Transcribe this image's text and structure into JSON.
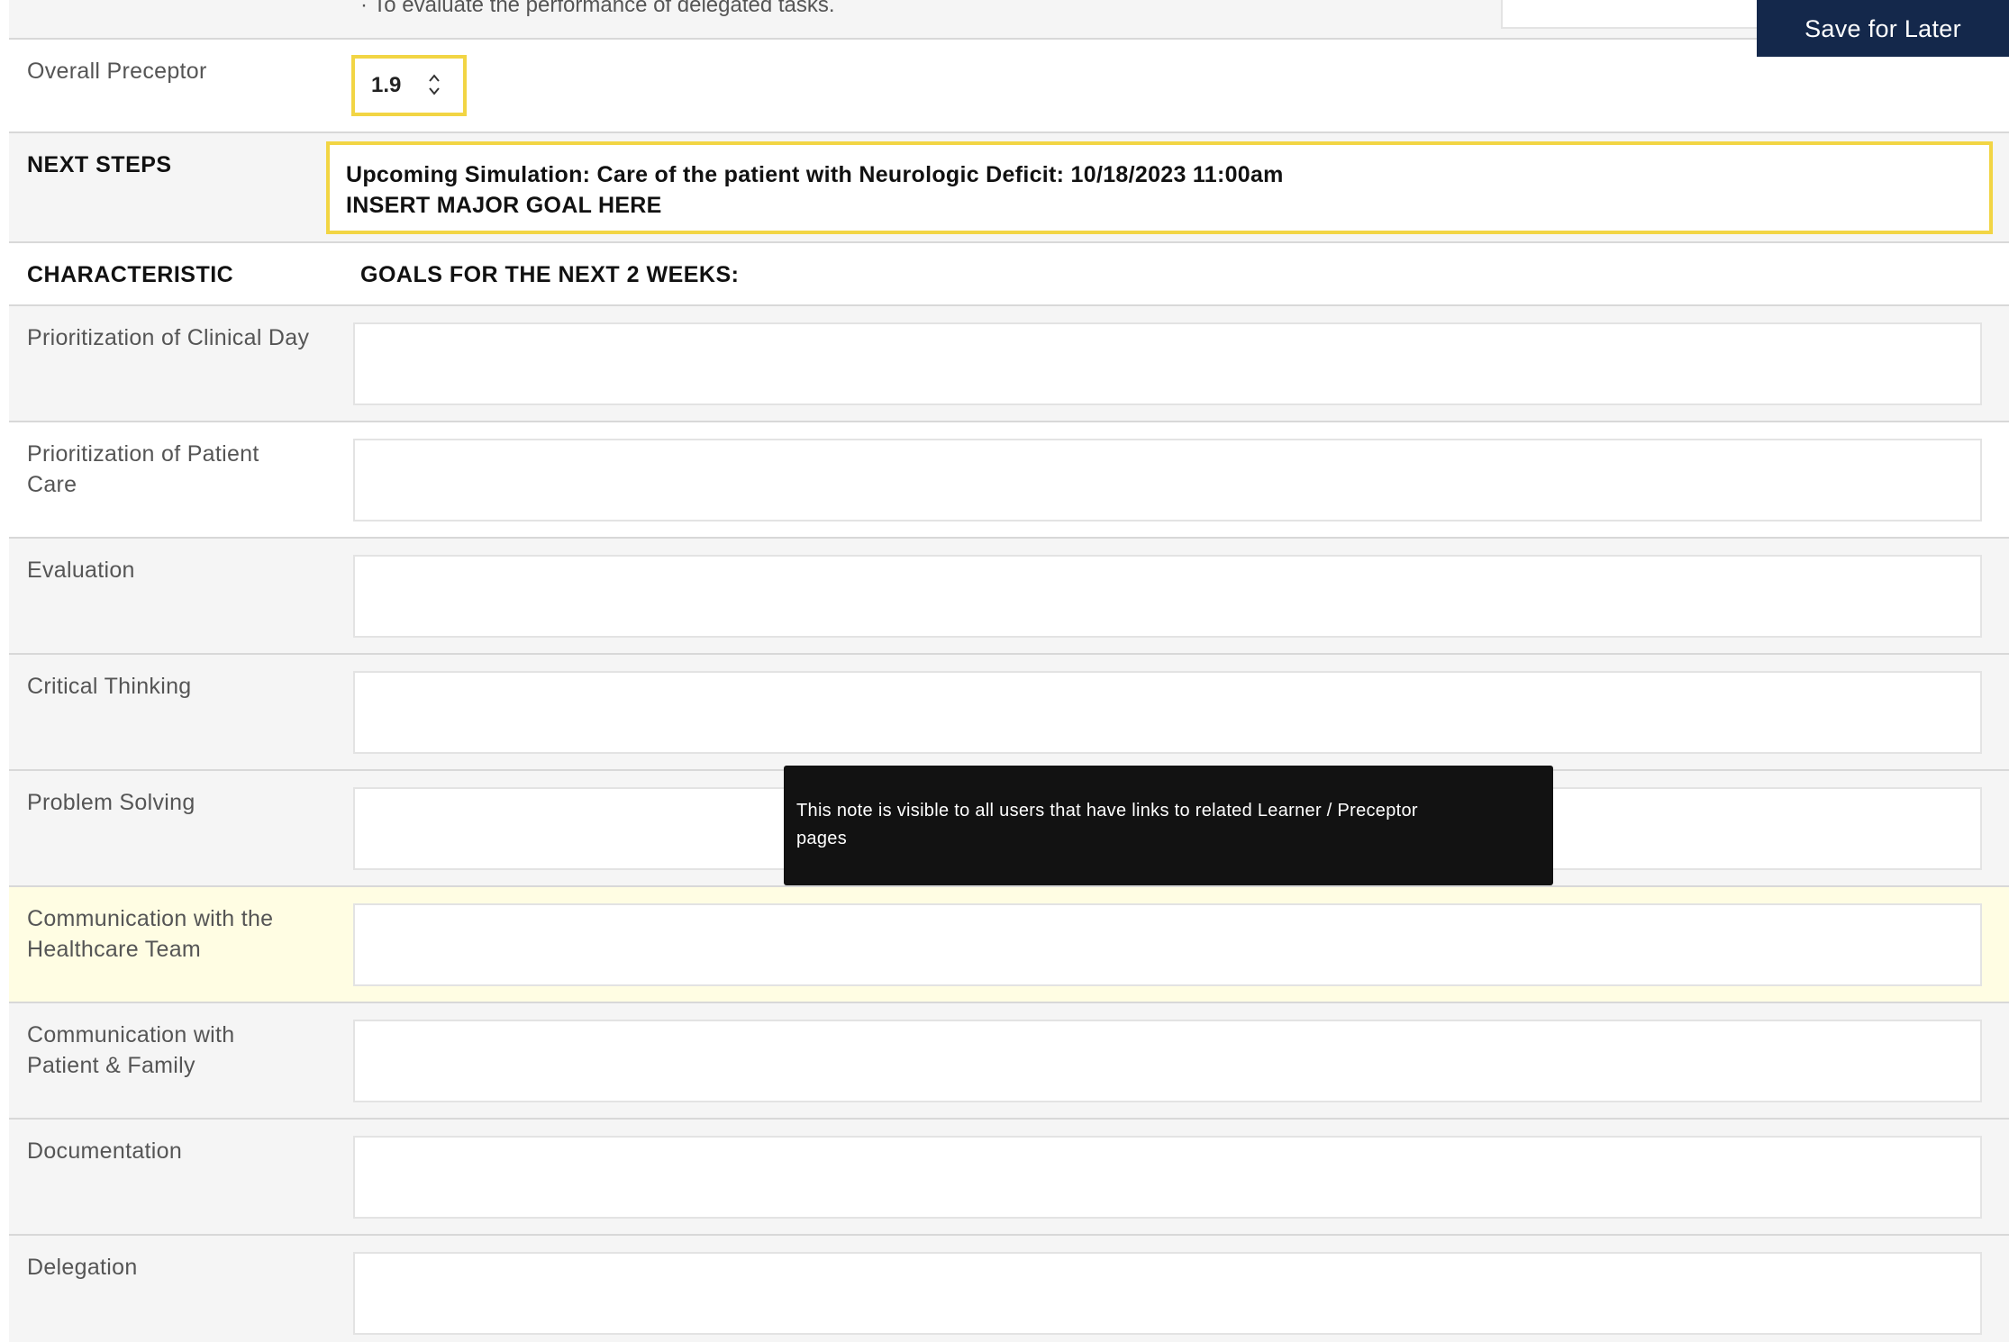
{
  "top_row": {
    "bullet_text": "· To evaluate the performance of delegated tasks."
  },
  "save_button": {
    "label": "Save for Later"
  },
  "overall": {
    "label": "Overall Preceptor",
    "value": "1.9"
  },
  "next_steps": {
    "label": "NEXT STEPS",
    "lines": [
      "Upcoming Simulation: Care of the patient with Neurologic Deficit: 10/18/2023 11:00am",
      "INSERT MAJOR GOAL HERE"
    ]
  },
  "table": {
    "header_characteristic": "CHARACTERISTIC",
    "header_goals": "GOALS FOR THE NEXT 2 WEEKS:",
    "rows": [
      {
        "label_lines": [
          "Prioritization of Clinical Day"
        ],
        "value": ""
      },
      {
        "label_lines": [
          "Prioritization of Patient",
          "Care"
        ],
        "value": ""
      },
      {
        "label_lines": [
          "Evaluation"
        ],
        "value": ""
      },
      {
        "label_lines": [
          "Critical Thinking"
        ],
        "value": ""
      },
      {
        "label_lines": [
          "Problem Solving"
        ],
        "value": ""
      },
      {
        "label_lines": [
          "Communication with the",
          "Healthcare Team"
        ],
        "value": ""
      },
      {
        "label_lines": [
          "Communication with",
          "Patient & Family"
        ],
        "value": ""
      },
      {
        "label_lines": [
          "Documentation"
        ],
        "value": ""
      },
      {
        "label_lines": [
          "Delegation"
        ],
        "value": ""
      }
    ]
  },
  "tooltip": {
    "line1": "This note is visible to all users that have links to related Learner / Preceptor",
    "line2": "pages"
  },
  "colors": {
    "accent_border": "#f2d544",
    "save_button_bg": "#14284b",
    "row_highlight": "#fffde3",
    "tooltip_bg": "#121212"
  }
}
